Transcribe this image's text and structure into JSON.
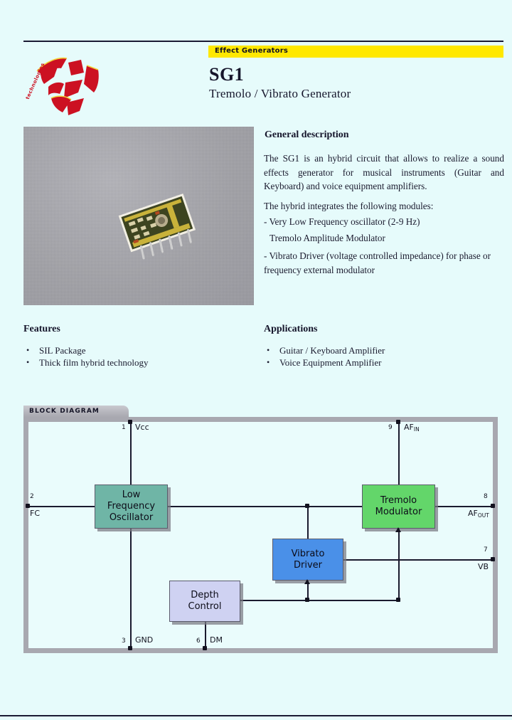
{
  "document": {
    "category_banner": "Effect Generators",
    "part_number": "SG1",
    "subtitle": "Tremolo / Vibrato Generator",
    "logo_wordmark": "technologies"
  },
  "general_description": {
    "heading": "General description",
    "paragraph_1": "The SG1 is an hybrid circuit that allows to realize a sound effects generator for musical instruments (Guitar and Keyboard) and voice equipment amplifiers.",
    "paragraph_2": "The hybrid integrates the following modules:",
    "module_1": "- Very Low Frequency oscillator (2-9 Hz)",
    "module_2": "Tremolo Amplitude Modulator",
    "module_3": "- Vibrato Driver (voltage controlled impedance) for phase or frequency external modulator"
  },
  "features": {
    "heading": "Features",
    "items": [
      "SIL Package",
      "Thick film hybrid technology"
    ]
  },
  "applications": {
    "heading": "Applications",
    "items": [
      "Guitar / Keyboard Amplifier",
      "Voice Equipment Amplifier"
    ]
  },
  "block_diagram": {
    "tab_label": "BLOCK DIAGRAM",
    "blocks": [
      {
        "id": "lfo",
        "line1": "Low",
        "line2": "Frequency",
        "line3": "Oscillator",
        "color": "#6fb5a6"
      },
      {
        "id": "tremolo",
        "line1": "Tremolo",
        "line2": "Modulator",
        "color": "#63d66a"
      },
      {
        "id": "vibrato",
        "line1": "Vibrato",
        "line2": "Driver",
        "color": "#4a90e8"
      },
      {
        "id": "depth",
        "line1": "Depth",
        "line2": "Control",
        "color": "#cfd2f2"
      }
    ],
    "pins": [
      {
        "num": "1",
        "name": "Vcc",
        "side": "top"
      },
      {
        "num": "9",
        "name": "AF",
        "sub": "IN",
        "side": "top"
      },
      {
        "num": "2",
        "name": "FC",
        "side": "left"
      },
      {
        "num": "8",
        "name": "AF",
        "sub": "OUT",
        "side": "right"
      },
      {
        "num": "7",
        "name": "VB",
        "side": "right"
      },
      {
        "num": "3",
        "name": "GND",
        "side": "bottom"
      },
      {
        "num": "6",
        "name": "DM",
        "side": "bottom"
      }
    ]
  },
  "colors": {
    "page_background": "#e6fbfb",
    "banner_yellow": "#ffe800",
    "logo_red": "#cc1122",
    "frame_gray": "#a8a8b0",
    "photo_gray": "#a9a9ae"
  }
}
